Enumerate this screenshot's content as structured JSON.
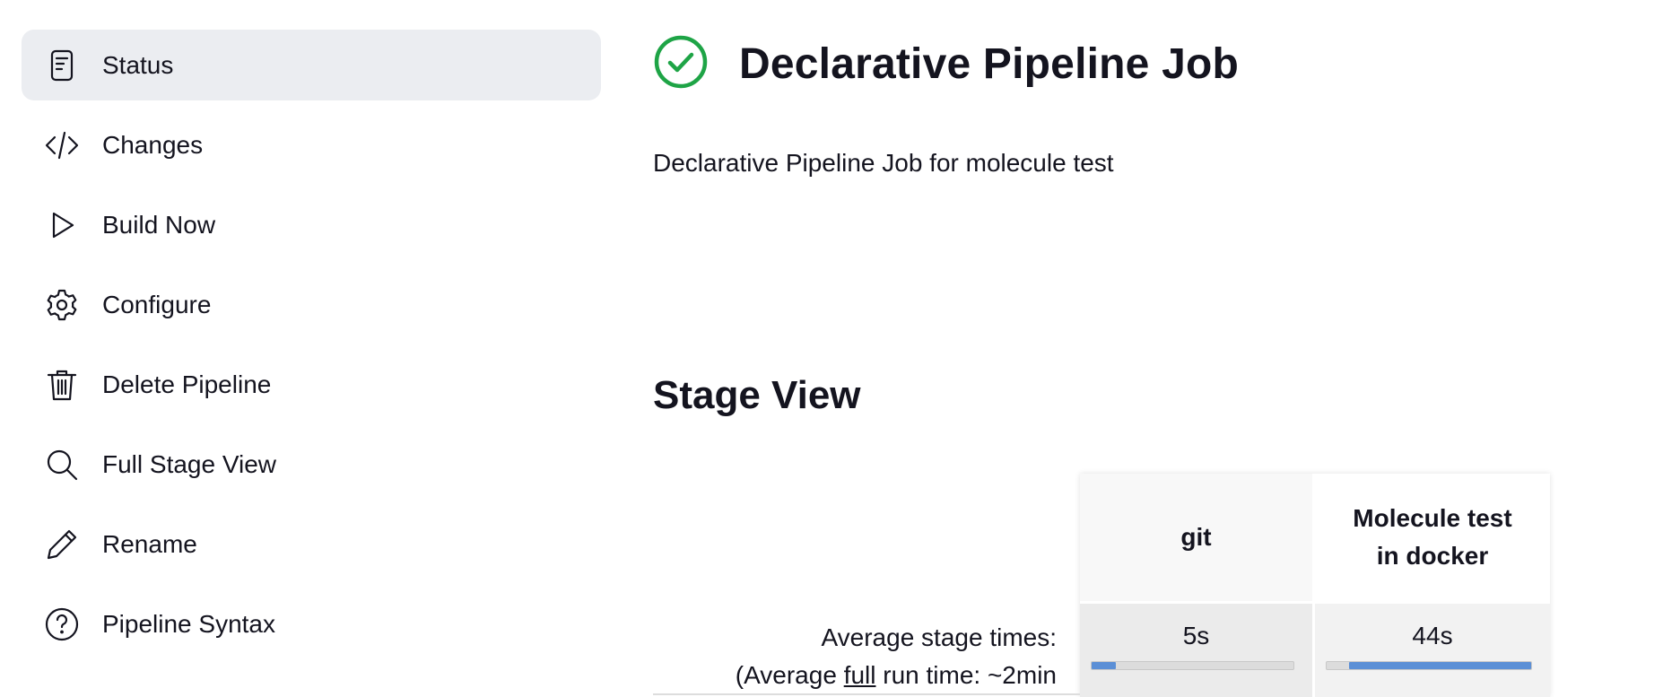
{
  "sidebar": {
    "items": [
      {
        "label": "Status",
        "icon": "document-icon",
        "active": true
      },
      {
        "label": "Changes",
        "icon": "code-icon"
      },
      {
        "label": "Build Now",
        "icon": "play-icon"
      },
      {
        "label": "Configure",
        "icon": "gear-icon"
      },
      {
        "label": "Delete Pipeline",
        "icon": "trash-icon"
      },
      {
        "label": "Full Stage View",
        "icon": "search-icon"
      },
      {
        "label": "Rename",
        "icon": "pencil-icon"
      },
      {
        "label": "Pipeline Syntax",
        "icon": "help-icon"
      }
    ]
  },
  "main": {
    "status_icon": "success-check-icon",
    "status_color": "#1ea446",
    "title": "Declarative Pipeline Job",
    "description": "Declarative Pipeline Job for molecule test",
    "stage_view_title": "Stage View",
    "avg_stage_times_label": "Average stage times:",
    "avg_run_prefix": "(Average ",
    "avg_run_link": "full",
    "avg_run_suffix": " run time: ~2min",
    "stages": [
      {
        "name": "git",
        "time": "5s",
        "bar_start": 0.0,
        "bar_fill": 0.12
      },
      {
        "name": "Molecule test in docker",
        "name_line1": "Molecule test",
        "name_line2": "in docker",
        "time": "44s",
        "bar_start": 0.11,
        "bar_fill": 0.89
      }
    ],
    "bar_color": "#5b8fd6"
  }
}
